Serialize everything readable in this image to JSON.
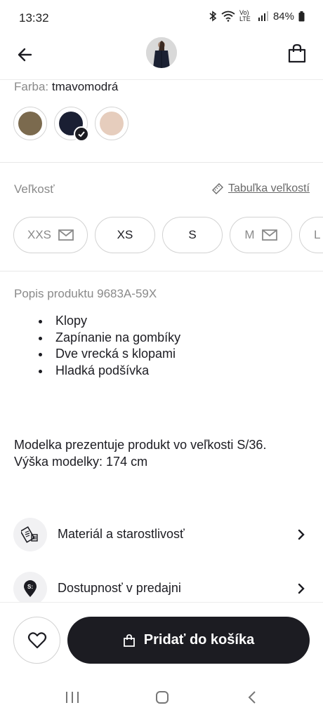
{
  "status_bar": {
    "time": "13:32",
    "network": "Vo) LTE",
    "battery": "84%"
  },
  "header": {
    "back_icon": "arrow-left-icon",
    "bag_icon": "shopping-bag-icon"
  },
  "color": {
    "label": "Farba:",
    "value": "tmavomodrá",
    "swatches": [
      {
        "color": "#7b6a4e",
        "selected": false
      },
      {
        "color": "#1a1f33",
        "selected": true
      },
      {
        "color": "#e6cdbd",
        "selected": false
      }
    ]
  },
  "size": {
    "label": "Veľkosť",
    "guide_label": "Tabuľka veľkostí",
    "options": [
      {
        "label": "XXS",
        "available": false
      },
      {
        "label": "XS",
        "available": true
      },
      {
        "label": "S",
        "available": true
      },
      {
        "label": "M",
        "available": false
      },
      {
        "label": "L",
        "available": false
      }
    ]
  },
  "description": {
    "title": "Popis produktu 9683A-59X",
    "bullets": [
      "Klopy",
      "Zapínanie na gombíky",
      "Dve vrecká s klopami",
      "Hladká podšívka"
    ],
    "model_line1": "Modelka prezentuje produkt vo veľkosti S/36.",
    "model_line2": "Výška modelky: 174 cm"
  },
  "rows": [
    {
      "label": "Materiál a starostlivosť",
      "icon": "fabric-label-icon"
    },
    {
      "label": "Dostupnosť v predajni",
      "icon": "store-pin-icon"
    }
  ],
  "actions": {
    "wishlist_icon": "heart-icon",
    "cart_label": "Pridať do košíka"
  }
}
